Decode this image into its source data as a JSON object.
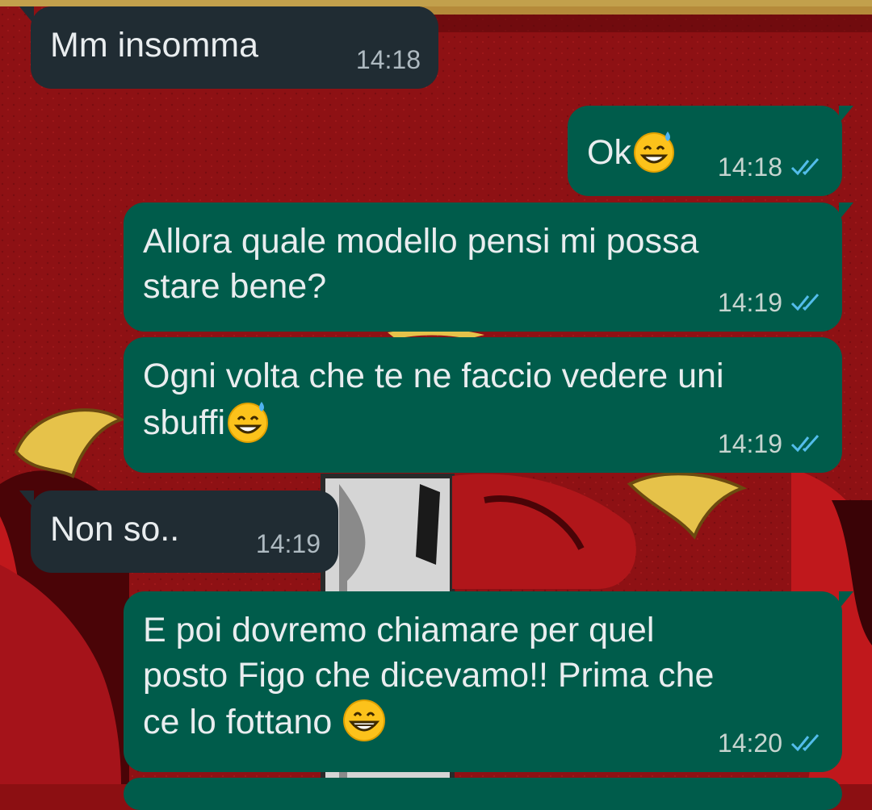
{
  "conversation": {
    "messages": [
      {
        "direction": "in",
        "text": "Mm insomma",
        "time": "14:18"
      },
      {
        "direction": "out",
        "text": "Ok",
        "emoji": "grinning-sweat-emoji",
        "time": "14:18",
        "status": "read"
      },
      {
        "direction": "out",
        "text": "Allora quale modello pensi mi possa\nstare bene?",
        "time": "14:19",
        "status": "read"
      },
      {
        "direction": "out",
        "text": "Ogni volta che te ne faccio vedere uni\nsbuffi",
        "emoji": "grinning-sweat-emoji",
        "time": "14:19",
        "status": "read"
      },
      {
        "direction": "in",
        "text": "Non so..",
        "time": "14:19"
      },
      {
        "direction": "out",
        "text": "E poi dovremo chiamare per quel\nposto Figo che dicevamo!! Prima che\nce lo fottano ",
        "emoji": "grinning-emoji",
        "time": "14:20",
        "status": "read"
      }
    ]
  },
  "colors": {
    "incoming_bubble": "#202c33",
    "outgoing_bubble": "#005c4b",
    "read_ticks": "#53bdeb",
    "wallpaper_red": "#8c0f12"
  }
}
